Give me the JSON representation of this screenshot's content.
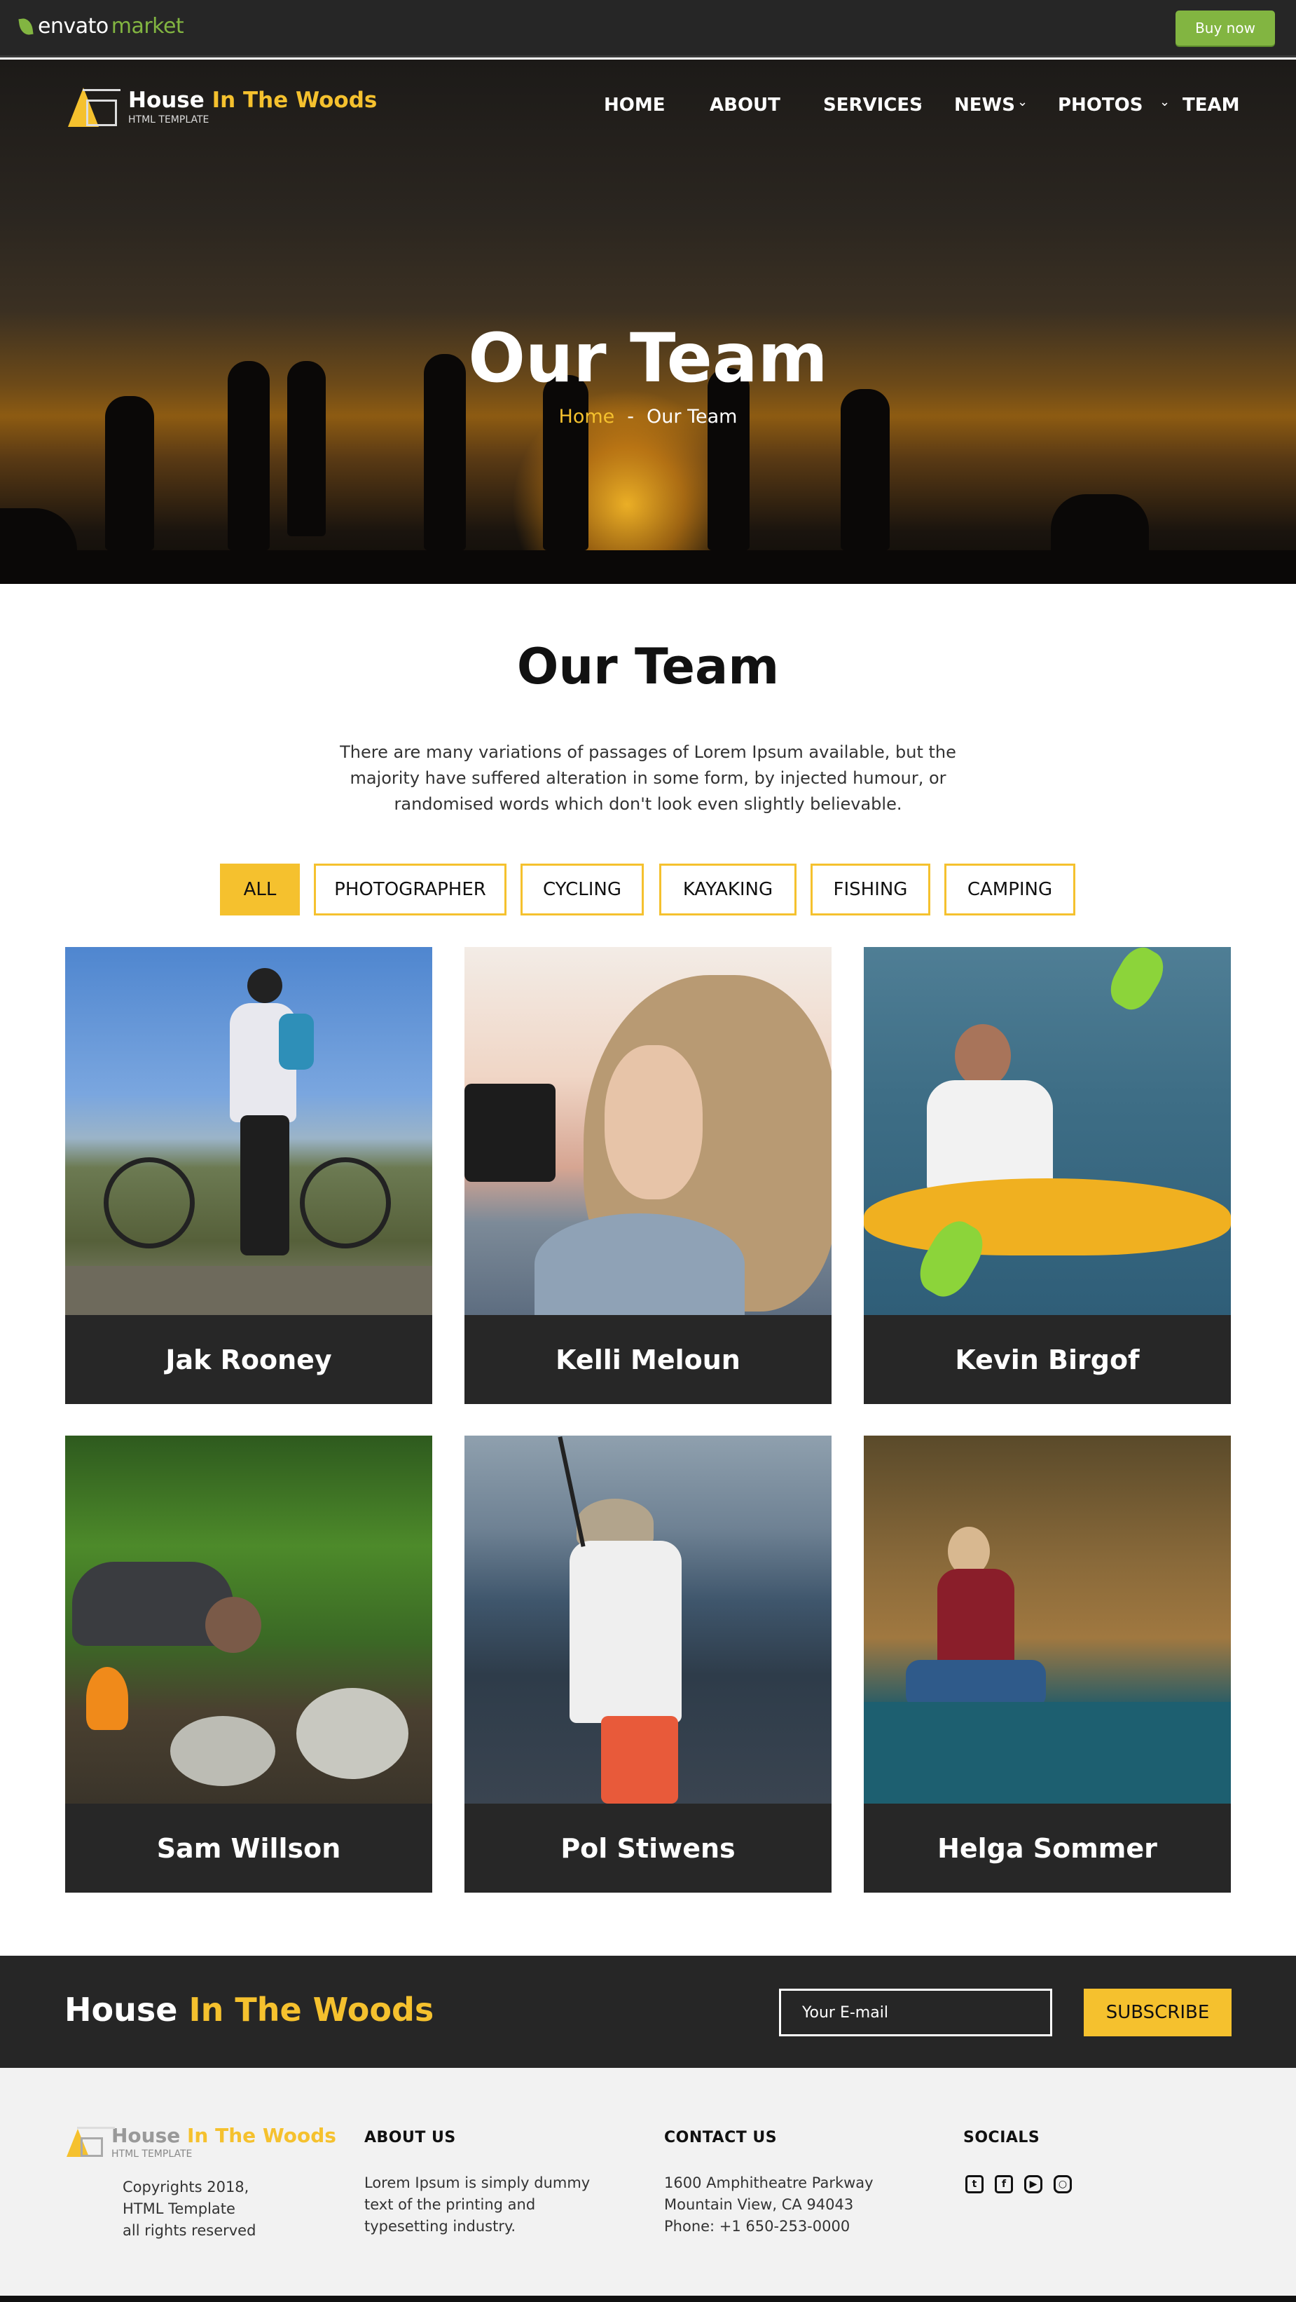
{
  "envato_bar": {
    "logo_part1": "envato",
    "logo_part2": "market",
    "buy_now": "Buy now"
  },
  "site": {
    "name_part1": "House",
    "name_part2": "In The Woods",
    "tagline": "HTML TEMPLATE"
  },
  "nav": {
    "items": [
      "HOME",
      "ABOUT",
      "SERVICES",
      "NEWS",
      "PHOTOS",
      "TEAM"
    ]
  },
  "hero": {
    "title": "Our Team",
    "breadcrumb_home": "Home",
    "breadcrumb_sep": "-",
    "breadcrumb_current": "Our Team"
  },
  "team_section": {
    "title": "Our Team",
    "description": "There are many variations of passages of Lorem Ipsum available, but the majority have suffered alteration in some form, by injected humour, or randomised words which don't look even slightly believable.",
    "filters": [
      "ALL",
      "PHOTOGRAPHER",
      "CYCLING",
      "KAYAKING",
      "FISHING",
      "CAMPING"
    ],
    "active_filter": "ALL",
    "members": [
      {
        "name": "Jak Rooney"
      },
      {
        "name": "Kelli Meloun"
      },
      {
        "name": "Kevin Birgof"
      },
      {
        "name": "Sam Willson"
      },
      {
        "name": "Pol Stiwens"
      },
      {
        "name": "Helga Sommer"
      }
    ]
  },
  "subscribe": {
    "brand_part1": "House",
    "brand_part2": "In The Woods",
    "email_placeholder": "Your E-mail",
    "button": "SUBSCRIBE"
  },
  "footer": {
    "copyright_line1": "Copyrights 2018,",
    "copyright_line2": "HTML Template",
    "copyright_line3": "all rights reserved",
    "about_title": "ABOUT US",
    "about_line1": "Lorem Ipsum is simply dummy",
    "about_line2": "text of the printing and",
    "about_line3": "typesetting industry.",
    "contact_title": "CONTACT US",
    "contact_line1": "1600 Amphitheatre Parkway",
    "contact_line2": "Mountain View, CA 94043",
    "contact_line3": "Phone: +1 650-253-0000",
    "socials_title": "SOCIALS",
    "socials": [
      "twitter-icon",
      "facebook-icon",
      "youtube-icon",
      "instagram-icon"
    ]
  },
  "colors": {
    "accent": "#f5c12e",
    "dark": "#262626",
    "envato_green": "#82b541"
  }
}
